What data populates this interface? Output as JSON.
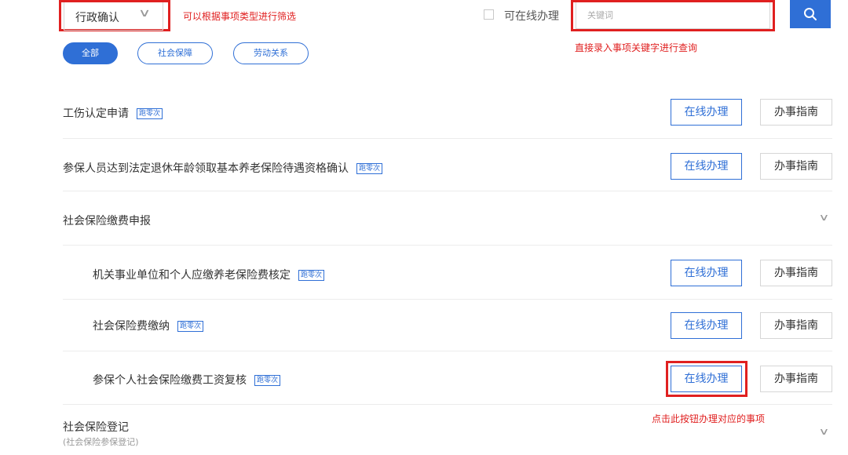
{
  "filter": {
    "type_select_value": "行政确认",
    "type_note": "可以根据事项类型进行筛选",
    "online_checkbox_label": "可在线办理",
    "search_placeholder": "关键词",
    "search_note": "直接录入事项关键字进行查询"
  },
  "categories": [
    {
      "label": "全部",
      "active": true
    },
    {
      "label": "社会保障",
      "active": false
    },
    {
      "label": "劳动关系",
      "active": false
    }
  ],
  "items": [
    {
      "name": "工伤认定申请",
      "tag": "跑零次",
      "online_label": "在线办理",
      "guide_label": "办事指南"
    },
    {
      "name": "参保人员达到法定退休年龄领取基本养老保险待遇资格确认",
      "tag": "跑零次",
      "online_label": "在线办理",
      "guide_label": "办事指南"
    }
  ],
  "group1": {
    "name": "社会保险缴费申报",
    "sub_items": [
      {
        "name": "机关事业单位和个人应缴养老保险费核定",
        "tag": "跑零次",
        "online_label": "在线办理",
        "guide_label": "办事指南"
      },
      {
        "name": "社会保险费缴纳",
        "tag": "跑零次",
        "online_label": "在线办理",
        "guide_label": "办事指南"
      },
      {
        "name": "参保个人社会保险缴费工资复核",
        "tag": "跑零次",
        "online_label": "在线办理",
        "guide_label": "办事指南"
      }
    ]
  },
  "online_button_note": "点击此按钮办理对应的事项",
  "group2": {
    "name": "社会保险登记",
    "subtitle": "(社会保险参保登记)"
  },
  "colors": {
    "accent": "#2f6fd6",
    "annotation": "#e02020"
  }
}
